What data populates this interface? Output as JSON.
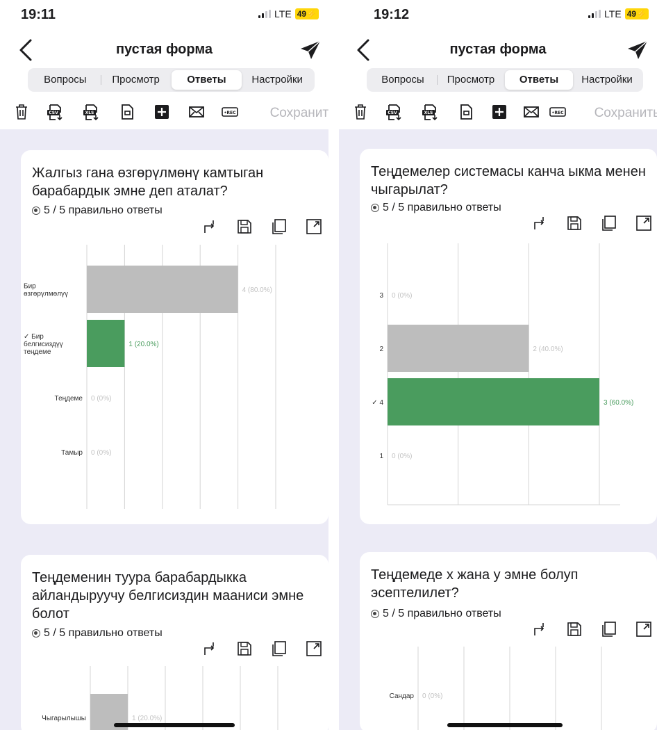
{
  "colors": {
    "correct_bar": "#4a9c5e",
    "other_bar": "#bdbdbd",
    "label_gray": "#c2c2c2",
    "label_green": "#4a9c5e",
    "content_bg": "#ecebf6"
  },
  "screens": [
    {
      "status": {
        "time": "19:11",
        "network": "LTE",
        "battery": "49"
      },
      "nav_title": "пустая форма",
      "tabs": [
        "Вопросы",
        "Просмотр",
        "Ответы",
        "Настройки"
      ],
      "active_tab": 2,
      "toolbar_icons": [
        "trash-icon",
        "csv-export-icon",
        "xls-export-icon",
        "document-icon",
        "add-icon",
        "mail-icon",
        "rec-icon"
      ],
      "save_label": "Сохранить",
      "cards": [
        {
          "question": "Жалгыз гана өзгөрүлмөнү камтыган барабардык эмне деп аталат?",
          "score_text": "5 / 5 правильно ответы",
          "card_icons": [
            "swap-icon",
            "save-icon",
            "copy-icon",
            "expand-icon"
          ],
          "chart_data": {
            "type": "bar",
            "orientation": "horizontal",
            "categories": [
              "Бир өзгөрүлмөлүү",
              "✓ Бир белгисиздүү теңдеме",
              "Теңдеме",
              "Тамыр"
            ],
            "values": [
              4,
              1,
              0,
              0
            ],
            "value_labels": [
              "4 (80.0%)",
              "1 (20.0%)",
              "0 (0%)",
              "0 (0%)"
            ],
            "correct": [
              false,
              true,
              false,
              false
            ],
            "xlim": [
              0,
              5
            ],
            "grid": true
          }
        },
        {
          "question": "Теңдеменин туура барабардыкка айландыруучу белгисиздин мааниси эмне болот",
          "score_text": "5 / 5 правильно ответы",
          "card_icons": [
            "swap-icon",
            "save-icon",
            "copy-icon",
            "expand-icon"
          ],
          "chart_data": {
            "type": "bar",
            "orientation": "horizontal",
            "categories": [
              "Чыгарылышы"
            ],
            "values": [
              1
            ],
            "value_labels": [
              "1 (20.0%)"
            ],
            "correct": [
              false
            ],
            "xlim": [
              0,
              5
            ],
            "grid": true
          }
        }
      ]
    },
    {
      "status": {
        "time": "19:12",
        "network": "LTE",
        "battery": "49"
      },
      "nav_title": "пустая форма",
      "tabs": [
        "Вопросы",
        "Просмотр",
        "Ответы",
        "Настройки"
      ],
      "active_tab": 2,
      "toolbar_icons": [
        "trash-icon",
        "csv-export-icon",
        "xls-export-icon",
        "document-icon",
        "add-icon",
        "mail-icon",
        "rec-icon"
      ],
      "save_label": "Сохранить",
      "cards": [
        {
          "question": "Теңдемелер системасы канча ыкма менен чыгарылат?",
          "score_text": "5 / 5 правильно ответы",
          "card_icons": [
            "swap-icon",
            "save-icon",
            "copy-icon",
            "expand-icon"
          ],
          "chart_data": {
            "type": "bar",
            "orientation": "horizontal",
            "categories": [
              "3",
              "2",
              "✓ 4",
              "1"
            ],
            "values": [
              0,
              2,
              3,
              0
            ],
            "value_labels": [
              "0 (0%)",
              "2 (40.0%)",
              "3 (60.0%)",
              "0 (0%)"
            ],
            "correct": [
              false,
              false,
              true,
              false
            ],
            "xlim": [
              0,
              3
            ],
            "grid": true
          }
        },
        {
          "question": "Теңдемеде х жана у эмне болуп эсептелилет?",
          "score_text": "5 / 5 правильно ответы",
          "card_icons": [
            "swap-icon",
            "save-icon",
            "copy-icon",
            "expand-icon"
          ],
          "chart_data": {
            "type": "bar",
            "orientation": "horizontal",
            "categories": [
              "Сандар"
            ],
            "values": [
              0
            ],
            "value_labels": [
              "0 (0%)"
            ],
            "correct": [
              false
            ],
            "xlim": [
              0,
              4
            ],
            "grid": true
          }
        }
      ]
    }
  ]
}
